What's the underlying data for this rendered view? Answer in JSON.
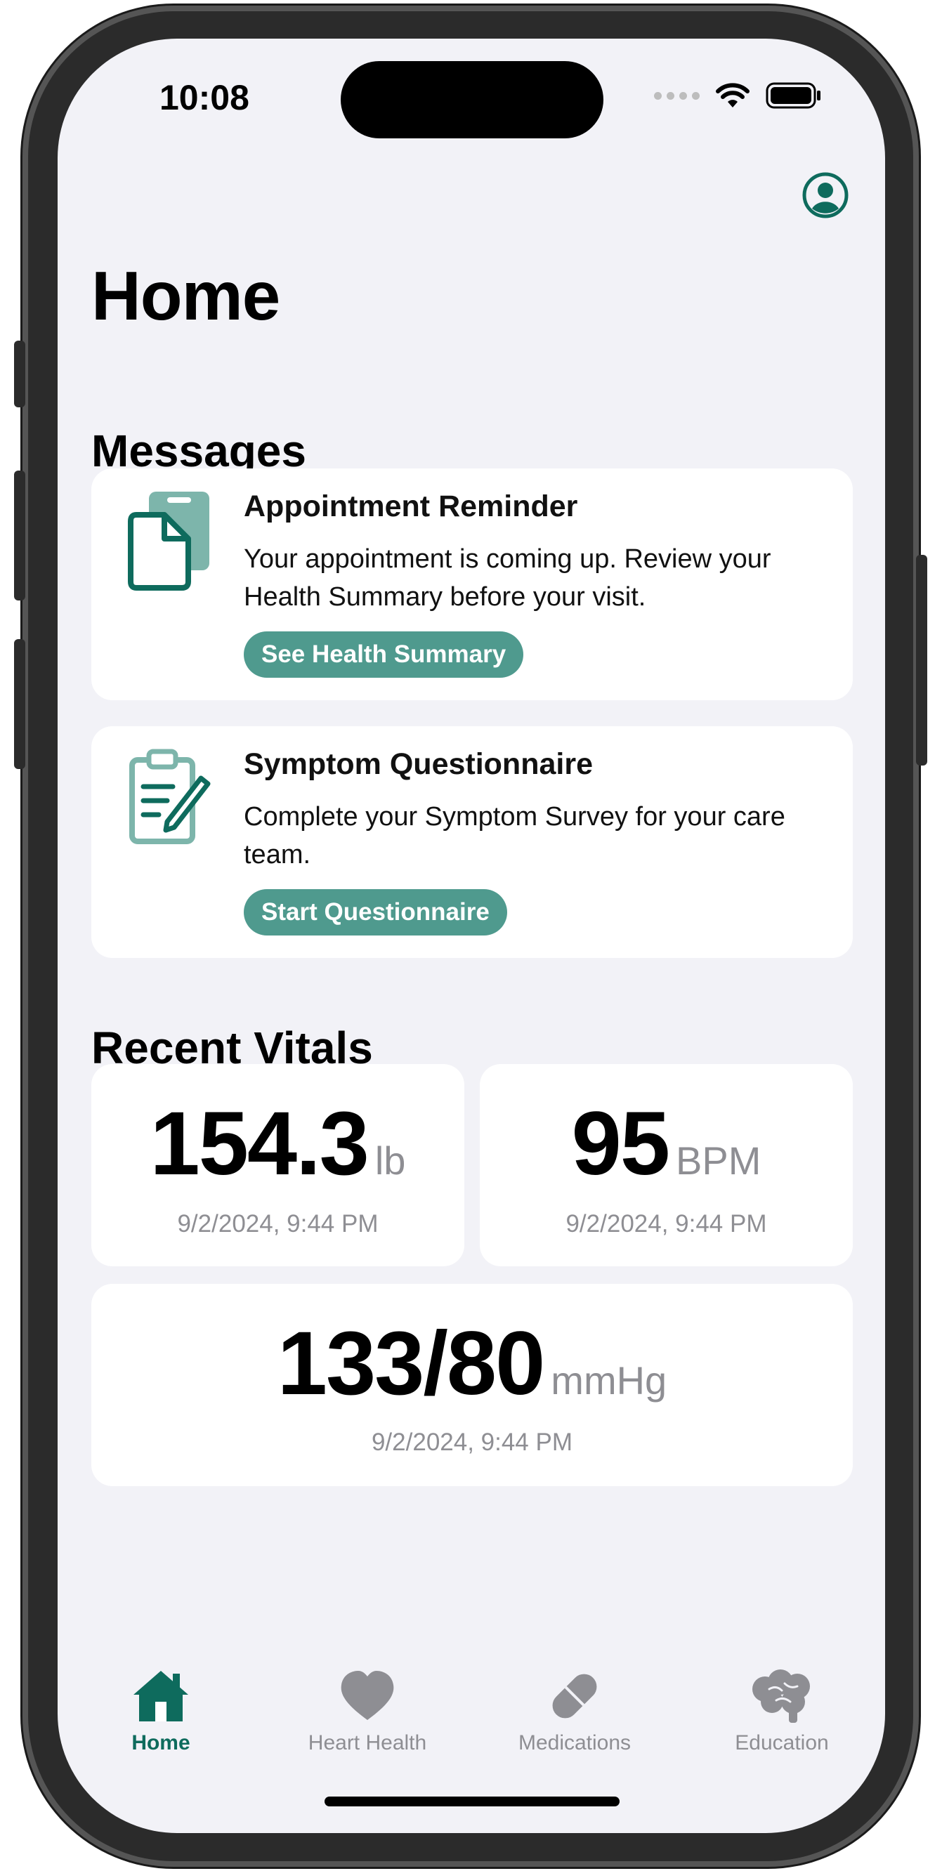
{
  "status_bar": {
    "time": "10:08",
    "signal_icon": "signal-dots-icon",
    "wifi_icon": "wifi-icon",
    "battery_icon": "battery-icon"
  },
  "header": {
    "account_icon": "account-circle-icon",
    "title": "Home"
  },
  "messages": {
    "section_title": "Messages",
    "items": [
      {
        "icon": "document-icon",
        "title": "Appointment Reminder",
        "body": "Your appointment is coming up. Review your Health Summary before your visit.",
        "button_label": "See Health Summary"
      },
      {
        "icon": "clipboard-pencil-icon",
        "title": "Symptom Questionnaire",
        "body": "Complete your Symptom Survey for your care team.",
        "button_label": "Start Questionnaire"
      }
    ]
  },
  "vitals": {
    "section_title": "Recent Vitals",
    "items": [
      {
        "value": "154.3",
        "unit": "lb",
        "date": "9/2/2024, 9:44 PM"
      },
      {
        "value": "95",
        "unit": "BPM",
        "date": "9/2/2024, 9:44 PM"
      },
      {
        "value": "133/80",
        "unit": "mmHg",
        "date": "9/2/2024, 9:44 PM"
      }
    ]
  },
  "tab_bar": {
    "tabs": [
      {
        "label": "Home",
        "icon": "house-icon",
        "active": true
      },
      {
        "label": "Heart Health",
        "icon": "heart-icon",
        "active": false
      },
      {
        "label": "Medications",
        "icon": "pill-icon",
        "active": false
      },
      {
        "label": "Education",
        "icon": "brain-icon",
        "active": false
      }
    ]
  },
  "colors": {
    "accent": "#0e6b5d",
    "button": "#4f9a8e",
    "background": "#f2f2f7",
    "muted_text": "#8e8e93"
  }
}
